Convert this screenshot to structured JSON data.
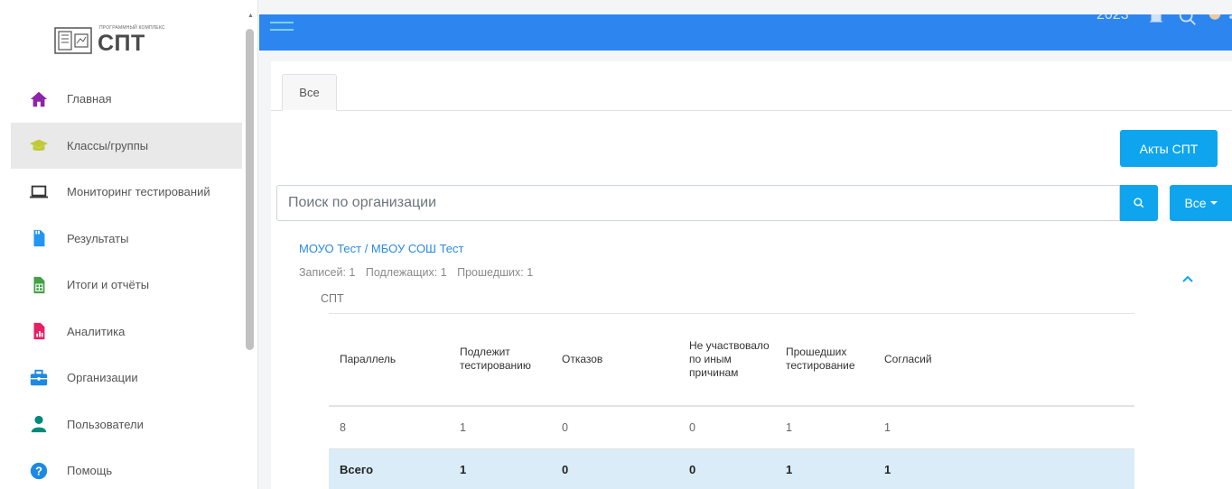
{
  "logo": {
    "small_text": "ПРОГРАММНЫЙ КОМПЛЕКС",
    "title": "СПТ"
  },
  "sidebar": {
    "items": [
      {
        "label": "Главная",
        "icon": "home-icon",
        "color": "#8e24aa"
      },
      {
        "label": "Классы/группы",
        "icon": "graduation-cap-icon",
        "color": "#c0ca33"
      },
      {
        "label": "Мониторинг тестирований",
        "icon": "laptop-icon",
        "color": "#333333"
      },
      {
        "label": "Результаты",
        "icon": "document-icon",
        "color": "#2196f3"
      },
      {
        "label": "Итоги и отчёты",
        "icon": "spreadsheet-icon",
        "color": "#43a047"
      },
      {
        "label": "Аналитика",
        "icon": "analytics-file-icon",
        "color": "#e91e63"
      },
      {
        "label": "Организации",
        "icon": "briefcase-icon",
        "color": "#1e88e5"
      },
      {
        "label": "Пользователи",
        "icon": "user-icon",
        "color": "#00897b"
      },
      {
        "label": "Помощь",
        "icon": "help-icon",
        "color": "#1e88e5"
      }
    ],
    "active_index": 1
  },
  "topbar": {
    "year": "2023",
    "color": "#2d86f0"
  },
  "tabs": [
    {
      "label": "Все"
    }
  ],
  "acts_button": {
    "label": "Акты СПТ"
  },
  "search": {
    "placeholder": "Поиск по организации",
    "value": ""
  },
  "filter_button": {
    "label": "Все"
  },
  "org": {
    "title": "МОУО Тест / МБОУ СОШ Тест",
    "stats": {
      "records": "Записей: 1",
      "subject": "Подлежащих: 1",
      "passed": "Прошедших: 1"
    },
    "section_label": "СПТ"
  },
  "table": {
    "headers": [
      "Параллель",
      "Подлежит тестированию",
      "Отказов",
      "Не участвовало по иным причинам",
      "Прошедших тестирование",
      "Согласий"
    ],
    "rows": [
      [
        "8",
        "1",
        "0",
        "0",
        "1",
        "1"
      ]
    ],
    "total": [
      "Всего",
      "1",
      "0",
      "0",
      "1",
      "1"
    ]
  },
  "colors": {
    "accent": "#0ea5ee",
    "link": "#2a8ae0",
    "total_row": "#d9ecf8"
  }
}
